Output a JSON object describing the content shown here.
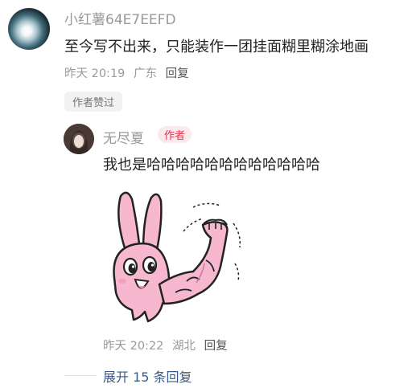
{
  "comment": {
    "username": "小红薯64E7EEFD",
    "text": "至今写不出来，只能装作一团挂面糊里糊涂地画",
    "time": "昨天 20:19",
    "location": "广东",
    "reply_label": "回复",
    "liked_badge": "作者赞过"
  },
  "reply": {
    "username": "无尽夏",
    "author_tag": "作者",
    "text": "我也是哈哈哈哈哈哈哈哈哈哈哈哈",
    "sticker_icon": "pink-rabbit-flexing-arm-sticker",
    "time": "昨天 20:22",
    "location": "湖北",
    "reply_label": "回复"
  },
  "expand": {
    "label": "展开 15 条回复"
  },
  "colors": {
    "meta_gray": "#9a9a9a",
    "author_red": "#e4344c",
    "author_tag_bg": "#fde9ec",
    "expand_blue": "#3a5a8a",
    "sticker_pink": "#f7b7cf"
  }
}
